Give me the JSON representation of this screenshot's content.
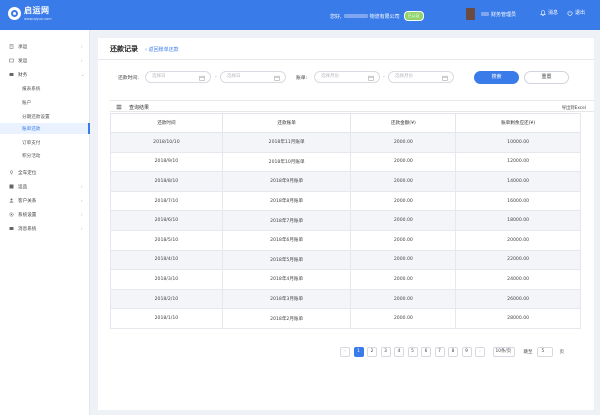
{
  "app": {
    "logo_name": "启运网",
    "logo_url": "www.qiyun.com",
    "greeting": "您好,",
    "company": "物流有限公司",
    "badge": "已认证",
    "user_role": "财务管理员",
    "message_label": "消息",
    "logout_label": "退出"
  },
  "sidebar": {
    "items": [
      {
        "label": "承运",
        "icon": "document-icon",
        "chevron": "›"
      },
      {
        "label": "发运",
        "icon": "box-icon",
        "chevron": "›"
      },
      {
        "label": "财务",
        "icon": "wallet-icon",
        "chevron": "⌄"
      },
      {
        "label": "报表系统",
        "sub": true
      },
      {
        "label": "账户",
        "sub": true
      },
      {
        "label": "分期还款设置",
        "sub": true
      },
      {
        "label": "账单还款",
        "sub": true,
        "active": true
      },
      {
        "label": "订单支付",
        "sub": true
      },
      {
        "label": "积分活动",
        "sub": true
      },
      {
        "label": "全车定位",
        "icon": "location-icon"
      },
      {
        "label": "运品",
        "icon": "goods-icon",
        "chevron": "›"
      },
      {
        "label": "客户关系",
        "icon": "people-icon",
        "chevron": "›"
      },
      {
        "label": "系统设置",
        "icon": "gear-icon",
        "chevron": "›"
      },
      {
        "label": "消息系统",
        "icon": "message-icon",
        "chevron": "›"
      }
    ]
  },
  "page": {
    "title": "还款记录",
    "back_label": "‹ 返回账单还款"
  },
  "filters": {
    "time_label": "还款时间:",
    "date_start_placeholder": "选择日",
    "date_end_placeholder": "选择日",
    "date_sep": "-",
    "bill_label": "账单:",
    "month_start_placeholder": "选择月份",
    "month_end_placeholder": "选择月份",
    "month_sep": "-",
    "query_label": "搜索",
    "reset_label": "重置"
  },
  "results": {
    "title": "查询结果",
    "export_label": "导出到Excel",
    "columns": [
      "还款时间",
      "还款账单",
      "还款金额(¥)",
      "账单剩余应还(¥)"
    ],
    "rows": [
      [
        "2018/10/10",
        "2018年11月账单",
        "2000.00",
        "10000.00"
      ],
      [
        "2018/9/10",
        "2018年10月账单",
        "2000.00",
        "12000.00"
      ],
      [
        "2018/8/10",
        "2018年9月账单",
        "2000.00",
        "14000.00"
      ],
      [
        "2018/7/10",
        "2018年8月账单",
        "2000.00",
        "16000.00"
      ],
      [
        "2018/6/10",
        "2018年7月账单",
        "2000.00",
        "18000.00"
      ],
      [
        "2018/5/10",
        "2018年6月账单",
        "2000.00",
        "20000.00"
      ],
      [
        "2018/4/10",
        "2018年5月账单",
        "2000.00",
        "22000.00"
      ],
      [
        "2018/3/10",
        "2018年4月账单",
        "2000.00",
        "24000.00"
      ],
      [
        "2018/2/10",
        "2018年3月账单",
        "2000.00",
        "26000.00"
      ],
      [
        "2018/1/10",
        "2018年2月账单",
        "2000.00",
        "28000.00"
      ]
    ]
  },
  "pagination": {
    "prev": "‹",
    "pages": [
      "1",
      "2",
      "3",
      "4",
      "5",
      "6",
      "7",
      "8",
      "9"
    ],
    "current": "1",
    "next": "›",
    "page_size": "10条/页",
    "jump_label": "跳至",
    "jump_value": "5",
    "jump_unit": "页"
  },
  "colors": {
    "accent": "#3a7bea",
    "badge": "#8fd36a"
  }
}
